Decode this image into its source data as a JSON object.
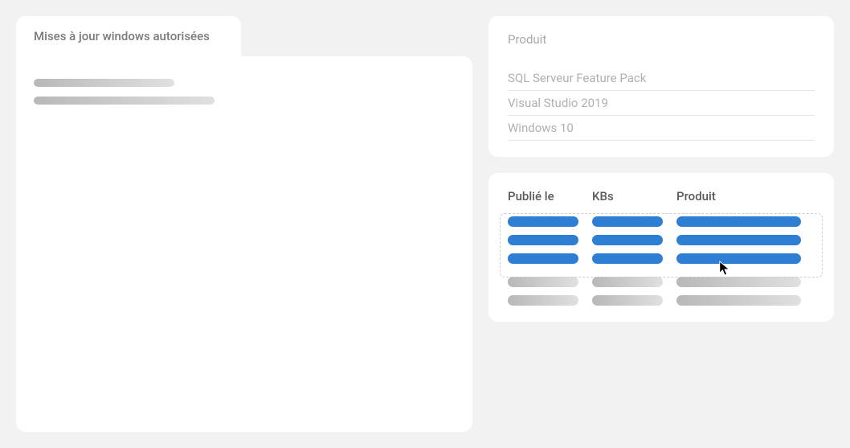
{
  "leftPanel": {
    "tabTitle": "Mises à jour windows autorisées"
  },
  "productCard": {
    "title": "Produit",
    "products": [
      "SQL Serveur Feature Pack",
      "Visual Studio 2019",
      "Windows 10"
    ]
  },
  "gridCard": {
    "headers": {
      "published": "Publié le",
      "kbs": "KBs",
      "product": "Produit"
    }
  },
  "colors": {
    "accent": "#2e7fd4",
    "muted": "#b0b0b0"
  }
}
